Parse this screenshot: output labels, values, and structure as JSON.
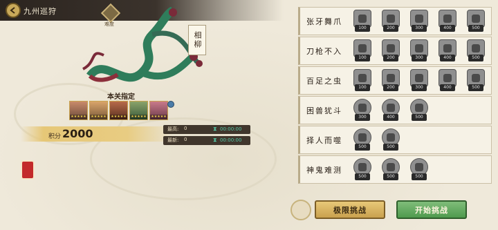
{
  "header": {
    "title": "九州巡狩",
    "level_label": "难度",
    "back_icon": "back-arrow-icon"
  },
  "stage": {
    "tag": "相柳",
    "banner": "本关指定"
  },
  "heroes": [
    {
      "name": "hero-1",
      "stars": "★★★★★"
    },
    {
      "name": "hero-2",
      "stars": "★★★★★"
    },
    {
      "name": "hero-3",
      "stars": "★★★★★"
    },
    {
      "name": "hero-4",
      "stars": "★★★★★"
    },
    {
      "name": "hero-5",
      "stars": "★★★★★"
    }
  ],
  "score": {
    "label": "积分",
    "value": "2000"
  },
  "stats": [
    {
      "key": "最高:",
      "value": "0",
      "time": "00:00:00"
    },
    {
      "key": "最新:",
      "value": "0",
      "time": "00:00:00"
    }
  ],
  "challenges": [
    {
      "name": "张牙舞爪",
      "items": [
        "100",
        "200",
        "300",
        "400",
        "500"
      ]
    },
    {
      "name": "刀枪不入",
      "items": [
        "100",
        "200",
        "300",
        "400",
        "500"
      ]
    },
    {
      "name": "百足之虫",
      "items": [
        "100",
        "200",
        "300",
        "400",
        "500"
      ]
    },
    {
      "name": "困兽犹斗",
      "items": [
        "300",
        "400",
        "500"
      ]
    },
    {
      "name": "择人而噬",
      "items": [
        "500",
        "500"
      ]
    },
    {
      "name": "神鬼难测",
      "items": [
        "500",
        "500",
        "500"
      ]
    }
  ],
  "buttons": {
    "limit": "极限挑战",
    "start": "开始挑战"
  },
  "colors": {
    "panel_row": "#f6f2e6",
    "btn_gold": "#c9a14e",
    "btn_green": "#4f9a4d",
    "time_text": "#55c8a8"
  }
}
